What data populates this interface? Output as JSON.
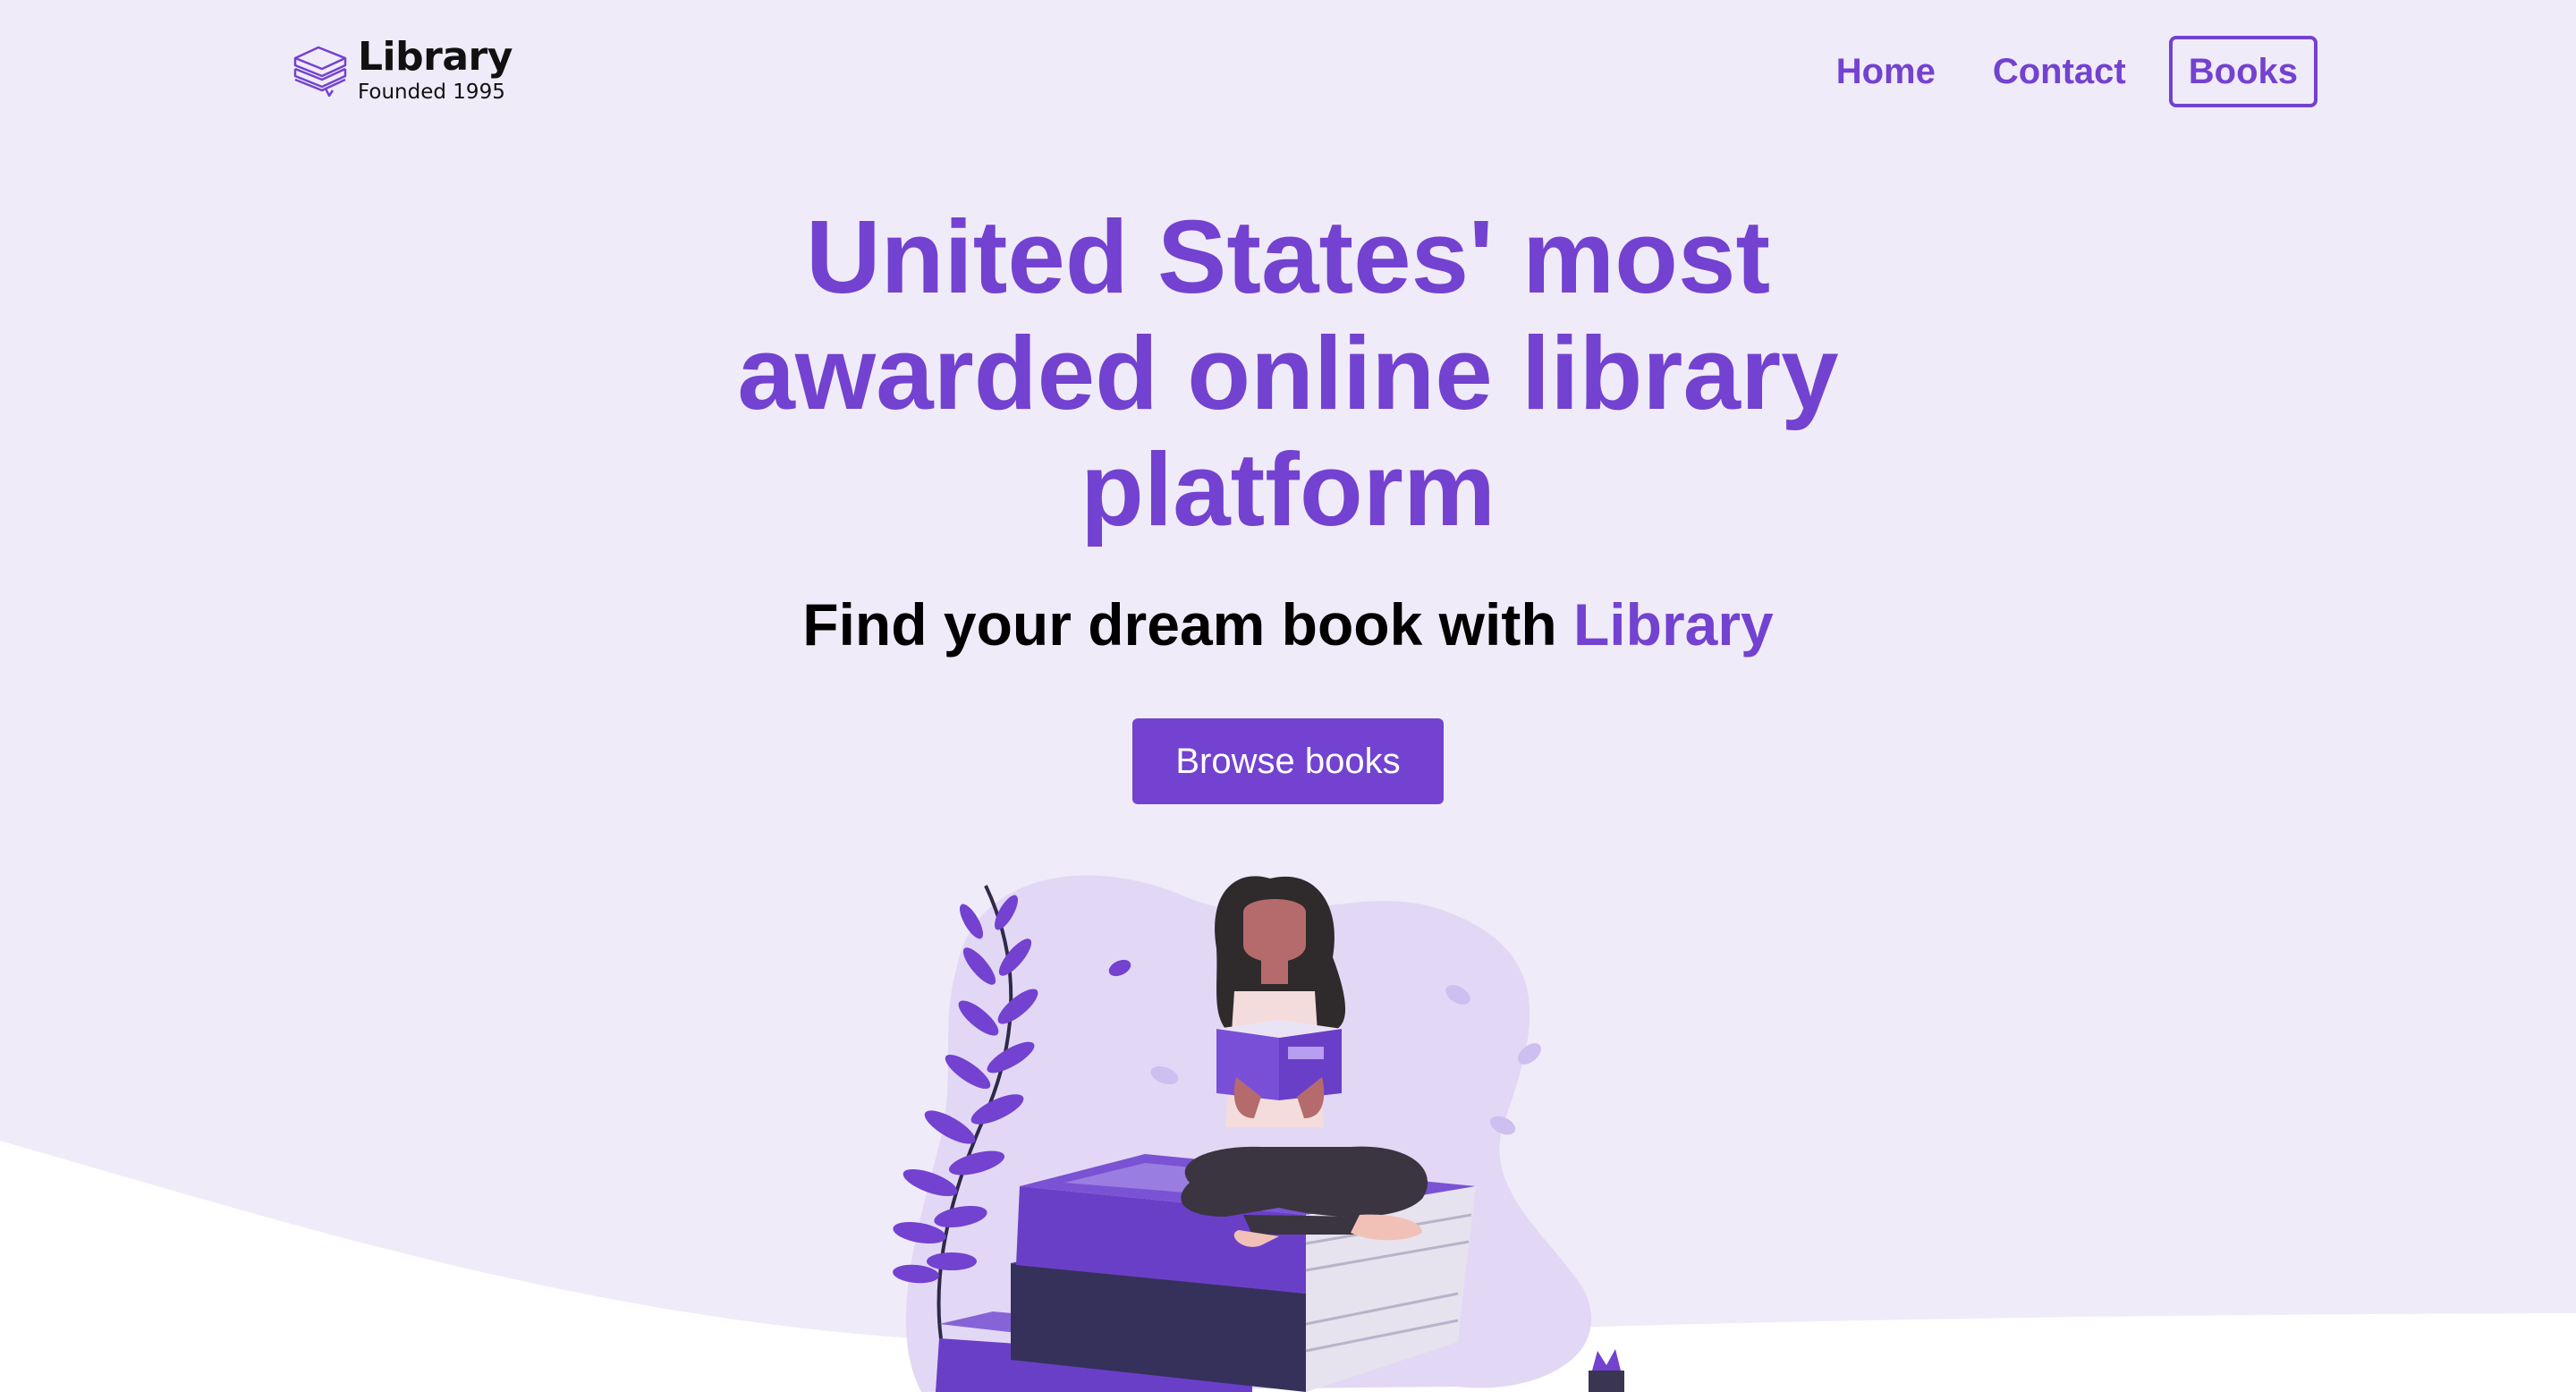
{
  "brand": {
    "name": "Library",
    "tagline": "Founded 1995",
    "icon": "books-stack-icon"
  },
  "nav": {
    "items": [
      {
        "label": "Home"
      },
      {
        "label": "Contact"
      },
      {
        "label": "Books"
      }
    ]
  },
  "hero": {
    "title_lines": [
      "United States' most",
      "awarded online library",
      "platform"
    ],
    "subtitle_prefix": "Find your dream book with ",
    "subtitle_accent": "Library",
    "cta_label": "Browse books"
  },
  "colors": {
    "accent": "#7342d0",
    "background": "#f0ebf8",
    "wave": "#ffffff"
  },
  "illustration": {
    "subject": "person-reading-on-books-illustration"
  }
}
